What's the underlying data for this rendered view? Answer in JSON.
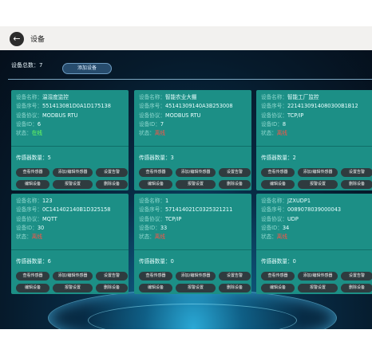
{
  "header": {
    "title": "设备",
    "back_icon": "←"
  },
  "toolbar": {
    "total": "设备总数：7",
    "add_button": "添加设备"
  },
  "cards": [
    {
      "name_label": "设备名称：",
      "name": "温湿度监控",
      "serial_label": "设备序号：",
      "serial": "551413081D0A1D175138",
      "protocol_label": "设备协议：",
      "protocol": "MODBUS RTU",
      "id_label": "设备ID：",
      "id": "6",
      "status_label": "状态：",
      "status": "在线",
      "sensor_label": "传感器数量：",
      "sensor_count": "5"
    },
    {
      "name_label": "设备名称：",
      "name": "智能农业大棚",
      "serial_label": "设备序号：",
      "serial": "45141309140A3B253008",
      "protocol_label": "设备协议：",
      "protocol": "MODBUS RTU",
      "id_label": "设备ID：",
      "id": "7",
      "status_label": "状态：",
      "status": "离线",
      "sensor_label": "传感器数量：",
      "sensor_count": "3"
    },
    {
      "name_label": "设备名称：",
      "name": "智能工厂监控",
      "serial_label": "设备序号：",
      "serial": "2214130914080300B1B12",
      "protocol_label": "设备协议：",
      "protocol": "TCP/IP",
      "id_label": "设备ID：",
      "id": "8",
      "status_label": "状态：",
      "status": "离线",
      "sensor_label": "传感器数量：",
      "sensor_count": "2"
    },
    {
      "name_label": "设备名称：",
      "name": "123",
      "serial_label": "设备序号：",
      "serial": "0C141402140B1D325158",
      "protocol_label": "设备协议：",
      "protocol": "MQTT",
      "id_label": "设备ID：",
      "id": "30",
      "status_label": "状态：",
      "status": "离线",
      "sensor_label": "传感器数量：",
      "sensor_count": "6"
    },
    {
      "name_label": "设备名称：",
      "name": "1",
      "serial_label": "设备序号：",
      "serial": "571414021C0325321211",
      "protocol_label": "设备协议：",
      "protocol": "TCP/IP",
      "id_label": "设备ID：",
      "id": "33",
      "status_label": "状态：",
      "status": "离线",
      "sensor_label": "传感器数量：",
      "sensor_count": "0"
    },
    {
      "name_label": "设备名称：",
      "name": "JZXUDP1",
      "serial_label": "设备序号：",
      "serial": "0089078039000043",
      "protocol_label": "设备协议：",
      "protocol": "UDP",
      "id_label": "设备ID：",
      "id": "34",
      "status_label": "状态：",
      "status": "离线",
      "sensor_label": "传感器数量：",
      "sensor_count": "0"
    }
  ],
  "card_buttons": {
    "view_sensors": "查看传感器",
    "add_edit_sensors": "添加/编辑传感器",
    "settings": "设置告警",
    "edit_device": "编辑设备",
    "alarm_settings": "报警设置",
    "delete_device": "删除设备"
  },
  "colors": {
    "card_bg": "#1c8f86",
    "online": "#6dff5c",
    "offline": "#ff5346",
    "button_bg": "#2f3b3f"
  }
}
